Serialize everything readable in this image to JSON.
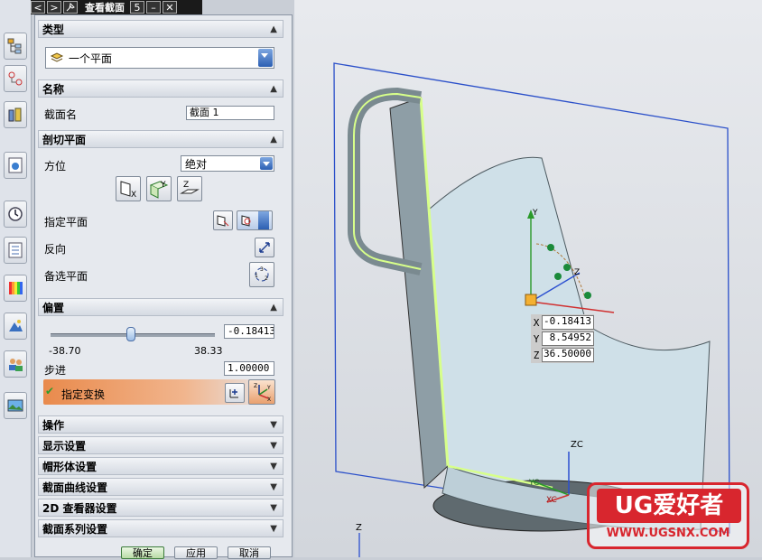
{
  "window": {
    "title": "查看截面",
    "reset_glyph": "5",
    "minimize_glyph": "–",
    "close_glyph": "✕",
    "back_glyph": "<",
    "forward_glyph": ">"
  },
  "sections": {
    "type": {
      "label": "类型",
      "value": "一个平面"
    },
    "name": {
      "label": "名称",
      "field_label": "截面名",
      "field_value": "截面 1"
    },
    "cut_plane": {
      "label": "剖切平面",
      "orientation_label": "方位",
      "orientation_value": "绝对",
      "axis_x": "X",
      "axis_y": "Y",
      "axis_z": "Z",
      "specify_plane_label": "指定平面",
      "reverse_label": "反向",
      "alt_plane_label": "备选平面"
    },
    "offset": {
      "label": "偏置",
      "value": "-0.18413",
      "min": "-38.70",
      "max": "38.33",
      "slider_position": 0.49,
      "step_label": "步进",
      "step_value": "1.00000",
      "transform_label": "指定变换"
    },
    "collapsed": [
      "操作",
      "显示设置",
      "帽形体设置",
      "截面曲线设置",
      "2D 查看器设置",
      "截面系列设置"
    ]
  },
  "buttons": {
    "ok": "确定",
    "apply": "应用",
    "cancel": "取消"
  },
  "viewport": {
    "coords": {
      "x_label": "X",
      "x": "-0.18413",
      "y_label": "Y",
      "y": "8.54952",
      "z_label": "Z",
      "z": "36.50000"
    },
    "triad_labels": {
      "zc": "ZC",
      "yc": "YC",
      "xc": "XC",
      "z": "Z",
      "y": "Y"
    },
    "watermark_main": "UG爱好者",
    "watermark_url": "WWW.UGSNX.COM"
  },
  "colors": {
    "accent": "#2c5fb3",
    "highlight": "#e98a4c",
    "plane": "#2a4fc9",
    "watermark": "#d8262e"
  }
}
